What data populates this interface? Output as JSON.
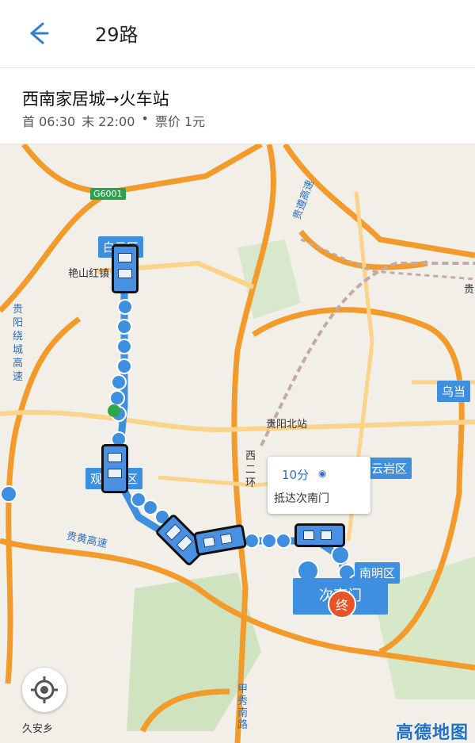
{
  "header": {
    "back_icon": "back-arrow-icon",
    "title": "29路"
  },
  "route": {
    "name": "西南家居城→火车站",
    "first": "首 06:30",
    "last": "末 22:00",
    "dot": "•",
    "fare": "票价 1元"
  },
  "map": {
    "highway_badge": "G6001",
    "districts": {
      "baiyun": "白云区",
      "guanshanhu": "观山湖区",
      "yunyan": "云岩区",
      "nanming_partial": "南明区",
      "wudang_partial": "乌当",
      "terminal_partial": "次南门"
    },
    "places": {
      "guiyang_north": "贵阳北站",
      "guiyang_east_partial": "贵",
      "mountain": "艳山红镇",
      "jiuanxiang": "久安乡",
      "ring_road": "贵阳绕城高速",
      "west_ring": "西二环",
      "guihuang": "贵黄高速",
      "guizun": "贵遵高速",
      "jiaxiu": "甲秀南路"
    },
    "popup": {
      "time": "10分",
      "arrive": "抵达次南门"
    },
    "end_marker": "终",
    "logo": "高德地图",
    "colors": {
      "highway": "#f39b2a",
      "road": "#fbd38a",
      "route": "#3f8fe0",
      "district": "#3f8fe0",
      "end": "#e8542a"
    }
  }
}
